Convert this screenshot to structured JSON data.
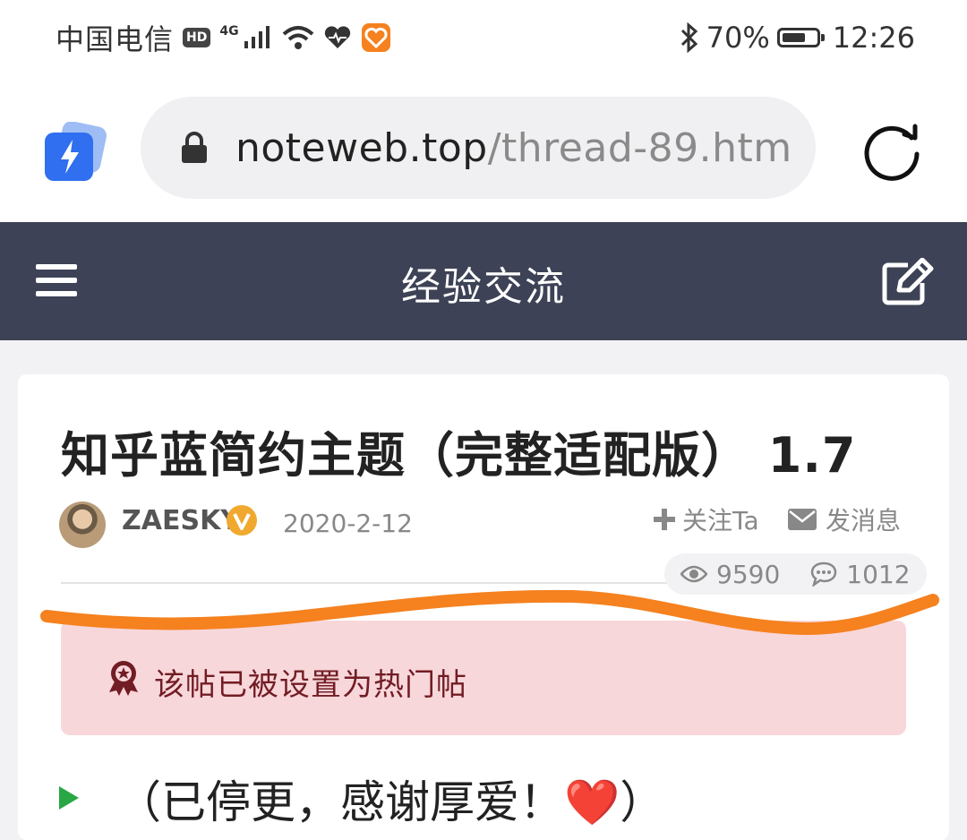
{
  "status_bar": {
    "carrier": "中国电信",
    "hd_badge": "HD",
    "network": "4G",
    "battery": "70%",
    "battery_level": 0.7,
    "time": "12:26"
  },
  "browser": {
    "url_host": "noteweb.top",
    "url_path": "/thread-89.htm"
  },
  "nav": {
    "title": "经验交流"
  },
  "post": {
    "title": "知乎蓝简约主题（完整适配版） 1.7",
    "author": "ZAESKY",
    "date": "2020-2-12",
    "follow_label": "关注Ta",
    "message_label": "发消息",
    "views": "9590",
    "replies": "1012",
    "notice": "该帖已被设置为热门帖",
    "intro_text": "（已停更，感谢厚爱！",
    "intro_emoji": "❤️",
    "intro_close": "）"
  },
  "colors": {
    "navbar": "#3d4256",
    "notice_bg": "#f8d7da",
    "notice_text": "#721c24",
    "annotation": "#f5811f",
    "verified": "#f0a92e",
    "app_icon": "#2f6ff0"
  },
  "icons": [
    "lock-icon",
    "reload-icon",
    "menu-icon",
    "edit-icon",
    "verified-icon",
    "plus-icon",
    "envelope-icon",
    "eye-icon",
    "comment-icon",
    "award-icon",
    "play-icon",
    "bluetooth-icon",
    "wifi-icon",
    "heart-icon",
    "health-app-icon",
    "signal-icon"
  ]
}
